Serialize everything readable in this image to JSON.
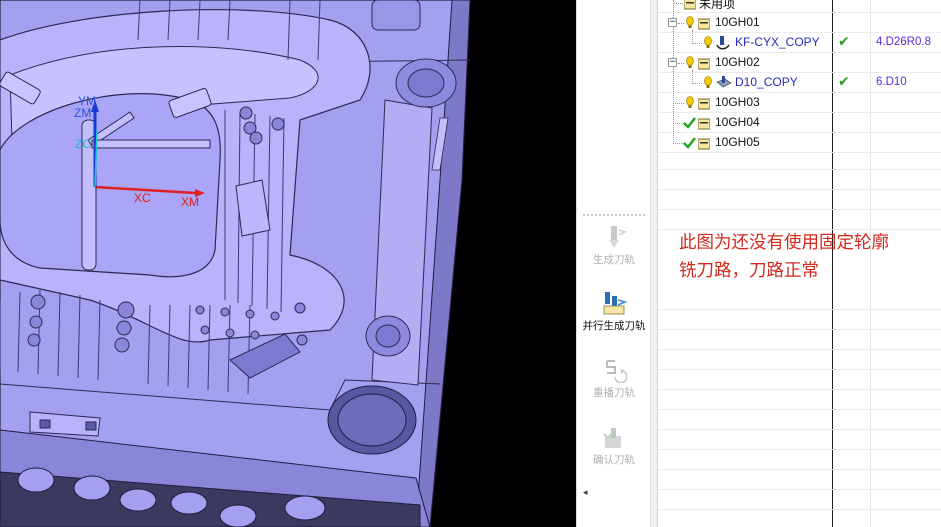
{
  "viewport": {
    "axes": {
      "ym": "YM",
      "zm": "ZM",
      "zc": "ZC",
      "xc": "XC",
      "xm": "XM"
    },
    "colors": {
      "background": "#000000",
      "part": "#a59ff0",
      "part_edge": "#2b2b55",
      "x_axis": "#e02020",
      "y_axis": "#1a3ad0"
    }
  },
  "commands": [
    {
      "id": "generate-toolpath",
      "label": "生成刀轨",
      "enabled": false,
      "icon": "generate-toolpath-icon"
    },
    {
      "id": "parallel-generate-toolpath",
      "label": "并行生成刀轨",
      "enabled": true,
      "icon": "parallel-generate-icon"
    },
    {
      "id": "replay-toolpath",
      "label": "重播刀轨",
      "enabled": false,
      "icon": "replay-toolpath-icon"
    },
    {
      "id": "verify-toolpath",
      "label": "确认刀轨",
      "enabled": false,
      "icon": "verify-toolpath-icon"
    }
  ],
  "tree": {
    "rows": [
      {
        "name": "未用项",
        "level": 0,
        "icon": "folder-icon",
        "status": "",
        "tool": ""
      },
      {
        "name": "10GH01",
        "level": 0,
        "icon": "folder-icon",
        "status": "pending",
        "tool": "",
        "expanded": true
      },
      {
        "name": "KF-CYX_COPY",
        "level": 1,
        "icon": "contour-mill-icon",
        "status": "pending",
        "check": "✔",
        "tool": "4.D26R0.8"
      },
      {
        "name": "10GH02",
        "level": 0,
        "icon": "folder-icon",
        "status": "pending",
        "tool": "",
        "expanded": true
      },
      {
        "name": "D10_COPY",
        "level": 1,
        "icon": "drill-op-icon",
        "status": "pending",
        "check": "✔",
        "tool": "6.D10"
      },
      {
        "name": "10GH03",
        "level": 0,
        "icon": "folder-icon",
        "status": "pending",
        "tool": ""
      },
      {
        "name": "10GH04",
        "level": 0,
        "icon": "folder-icon",
        "status": "done",
        "tool": ""
      },
      {
        "name": "10GH05",
        "level": 0,
        "icon": "folder-icon",
        "status": "done",
        "tool": ""
      }
    ]
  },
  "annotation": {
    "line1": "此图为还没有使用固定轮廓",
    "line2": "铣刀路，刀路正常"
  }
}
